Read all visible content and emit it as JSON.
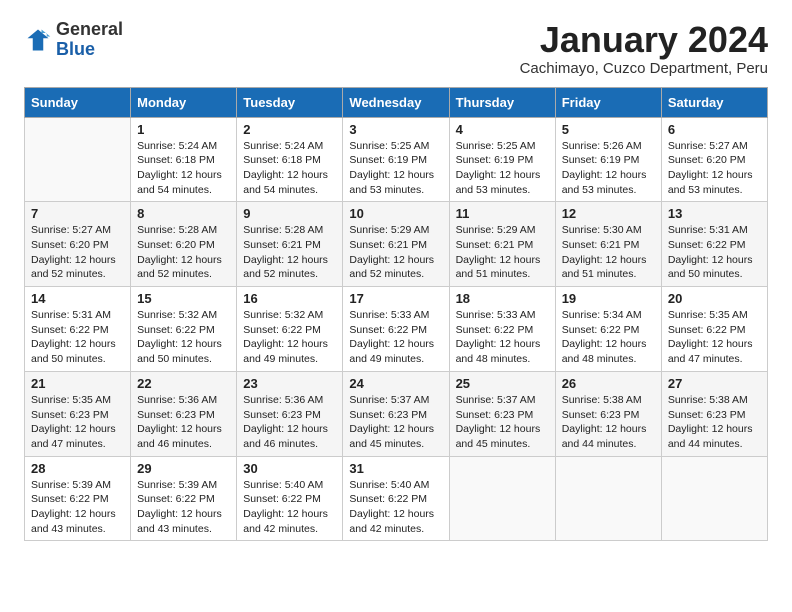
{
  "logo": {
    "general": "General",
    "blue": "Blue"
  },
  "title": "January 2024",
  "subtitle": "Cachimayo, Cuzco Department, Peru",
  "days_of_week": [
    "Sunday",
    "Monday",
    "Tuesday",
    "Wednesday",
    "Thursday",
    "Friday",
    "Saturday"
  ],
  "weeks": [
    [
      {
        "num": "",
        "info": ""
      },
      {
        "num": "1",
        "info": "Sunrise: 5:24 AM\nSunset: 6:18 PM\nDaylight: 12 hours\nand 54 minutes."
      },
      {
        "num": "2",
        "info": "Sunrise: 5:24 AM\nSunset: 6:18 PM\nDaylight: 12 hours\nand 54 minutes."
      },
      {
        "num": "3",
        "info": "Sunrise: 5:25 AM\nSunset: 6:19 PM\nDaylight: 12 hours\nand 53 minutes."
      },
      {
        "num": "4",
        "info": "Sunrise: 5:25 AM\nSunset: 6:19 PM\nDaylight: 12 hours\nand 53 minutes."
      },
      {
        "num": "5",
        "info": "Sunrise: 5:26 AM\nSunset: 6:19 PM\nDaylight: 12 hours\nand 53 minutes."
      },
      {
        "num": "6",
        "info": "Sunrise: 5:27 AM\nSunset: 6:20 PM\nDaylight: 12 hours\nand 53 minutes."
      }
    ],
    [
      {
        "num": "7",
        "info": "Sunrise: 5:27 AM\nSunset: 6:20 PM\nDaylight: 12 hours\nand 52 minutes."
      },
      {
        "num": "8",
        "info": "Sunrise: 5:28 AM\nSunset: 6:20 PM\nDaylight: 12 hours\nand 52 minutes."
      },
      {
        "num": "9",
        "info": "Sunrise: 5:28 AM\nSunset: 6:21 PM\nDaylight: 12 hours\nand 52 minutes."
      },
      {
        "num": "10",
        "info": "Sunrise: 5:29 AM\nSunset: 6:21 PM\nDaylight: 12 hours\nand 52 minutes."
      },
      {
        "num": "11",
        "info": "Sunrise: 5:29 AM\nSunset: 6:21 PM\nDaylight: 12 hours\nand 51 minutes."
      },
      {
        "num": "12",
        "info": "Sunrise: 5:30 AM\nSunset: 6:21 PM\nDaylight: 12 hours\nand 51 minutes."
      },
      {
        "num": "13",
        "info": "Sunrise: 5:31 AM\nSunset: 6:22 PM\nDaylight: 12 hours\nand 50 minutes."
      }
    ],
    [
      {
        "num": "14",
        "info": "Sunrise: 5:31 AM\nSunset: 6:22 PM\nDaylight: 12 hours\nand 50 minutes."
      },
      {
        "num": "15",
        "info": "Sunrise: 5:32 AM\nSunset: 6:22 PM\nDaylight: 12 hours\nand 50 minutes."
      },
      {
        "num": "16",
        "info": "Sunrise: 5:32 AM\nSunset: 6:22 PM\nDaylight: 12 hours\nand 49 minutes."
      },
      {
        "num": "17",
        "info": "Sunrise: 5:33 AM\nSunset: 6:22 PM\nDaylight: 12 hours\nand 49 minutes."
      },
      {
        "num": "18",
        "info": "Sunrise: 5:33 AM\nSunset: 6:22 PM\nDaylight: 12 hours\nand 48 minutes."
      },
      {
        "num": "19",
        "info": "Sunrise: 5:34 AM\nSunset: 6:22 PM\nDaylight: 12 hours\nand 48 minutes."
      },
      {
        "num": "20",
        "info": "Sunrise: 5:35 AM\nSunset: 6:22 PM\nDaylight: 12 hours\nand 47 minutes."
      }
    ],
    [
      {
        "num": "21",
        "info": "Sunrise: 5:35 AM\nSunset: 6:23 PM\nDaylight: 12 hours\nand 47 minutes."
      },
      {
        "num": "22",
        "info": "Sunrise: 5:36 AM\nSunset: 6:23 PM\nDaylight: 12 hours\nand 46 minutes."
      },
      {
        "num": "23",
        "info": "Sunrise: 5:36 AM\nSunset: 6:23 PM\nDaylight: 12 hours\nand 46 minutes."
      },
      {
        "num": "24",
        "info": "Sunrise: 5:37 AM\nSunset: 6:23 PM\nDaylight: 12 hours\nand 45 minutes."
      },
      {
        "num": "25",
        "info": "Sunrise: 5:37 AM\nSunset: 6:23 PM\nDaylight: 12 hours\nand 45 minutes."
      },
      {
        "num": "26",
        "info": "Sunrise: 5:38 AM\nSunset: 6:23 PM\nDaylight: 12 hours\nand 44 minutes."
      },
      {
        "num": "27",
        "info": "Sunrise: 5:38 AM\nSunset: 6:23 PM\nDaylight: 12 hours\nand 44 minutes."
      }
    ],
    [
      {
        "num": "28",
        "info": "Sunrise: 5:39 AM\nSunset: 6:22 PM\nDaylight: 12 hours\nand 43 minutes."
      },
      {
        "num": "29",
        "info": "Sunrise: 5:39 AM\nSunset: 6:22 PM\nDaylight: 12 hours\nand 43 minutes."
      },
      {
        "num": "30",
        "info": "Sunrise: 5:40 AM\nSunset: 6:22 PM\nDaylight: 12 hours\nand 42 minutes."
      },
      {
        "num": "31",
        "info": "Sunrise: 5:40 AM\nSunset: 6:22 PM\nDaylight: 12 hours\nand 42 minutes."
      },
      {
        "num": "",
        "info": ""
      },
      {
        "num": "",
        "info": ""
      },
      {
        "num": "",
        "info": ""
      }
    ]
  ]
}
